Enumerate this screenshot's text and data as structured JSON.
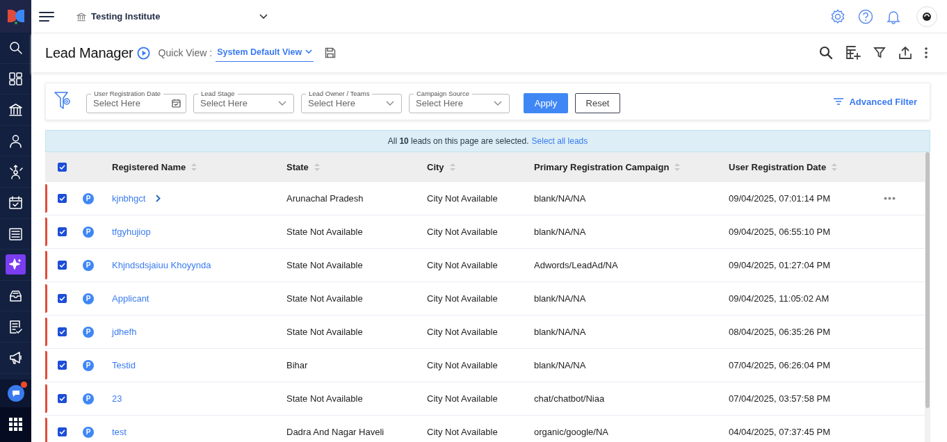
{
  "sidebar": {
    "items": [
      {
        "selected": false
      },
      {
        "selected": false
      },
      {
        "selected": false
      },
      {
        "selected": false
      },
      {
        "selected": false
      },
      {
        "selected": false
      },
      {
        "selected": false
      },
      {
        "selected": true
      },
      {
        "selected": false
      },
      {
        "selected": false
      },
      {
        "selected": false
      }
    ],
    "chat": {
      "has_notification": true
    }
  },
  "topbar": {
    "institute": "Testing Institute"
  },
  "header": {
    "title": "Lead Manager",
    "quick_view_label": "Quick View :",
    "quick_view_value": "System Default View"
  },
  "filters": {
    "fields": [
      {
        "label": "User Registration Date",
        "placeholder": "Select Here",
        "kind": "date"
      },
      {
        "label": "Lead Stage",
        "placeholder": "Select Here",
        "kind": "select"
      },
      {
        "label": "Lead Owner / Teams",
        "placeholder": "Select Here",
        "kind": "select"
      },
      {
        "label": "Campaign Source",
        "placeholder": "Select Here",
        "kind": "select"
      }
    ],
    "apply": "Apply",
    "reset": "Reset",
    "advanced": "Advanced Filter"
  },
  "selection_banner": {
    "text": "All **10** leads on this page are selected.",
    "link": "Select all leads"
  },
  "table": {
    "all_selected": true,
    "columns": [
      "Registered Name",
      "State",
      "City",
      "Primary Registration Campaign",
      "User Registration Date"
    ],
    "rows": [
      {
        "selected": true,
        "badge": "P",
        "name": "kjnbhgct",
        "expandable": true,
        "state": "Arunachal Pradesh",
        "city": "City Not Available",
        "campaign": "blank/NA/NA",
        "date": "09/04/2025, 07:01:14 PM",
        "show_actions": true
      },
      {
        "selected": true,
        "badge": "P",
        "name": "tfgyhujiop",
        "expandable": false,
        "state": "State Not Available",
        "city": "City Not Available",
        "campaign": "blank/NA/NA",
        "date": "09/04/2025, 06:55:10 PM",
        "show_actions": false
      },
      {
        "selected": true,
        "badge": "P",
        "name": "Khjndsdsjaiuu Khoyynda",
        "expandable": false,
        "state": "State Not Available",
        "city": "City Not Available",
        "campaign": "Adwords/LeadAd/NA",
        "date": "09/04/2025, 01:27:04 PM",
        "show_actions": false
      },
      {
        "selected": true,
        "badge": "P",
        "name": "Applicant",
        "expandable": false,
        "state": "State Not Available",
        "city": "City Not Available",
        "campaign": "blank/NA/NA",
        "date": "09/04/2025, 11:05:02 AM",
        "show_actions": false
      },
      {
        "selected": true,
        "badge": "P",
        "name": "jdhefh",
        "expandable": false,
        "state": "State Not Available",
        "city": "City Not Available",
        "campaign": "blank/NA/NA",
        "date": "08/04/2025, 06:35:26 PM",
        "show_actions": false
      },
      {
        "selected": true,
        "badge": "P",
        "name": "Testid",
        "expandable": false,
        "state": "Bihar",
        "city": "City Not Available",
        "campaign": "blank/NA/NA",
        "date": "07/04/2025, 06:26:04 PM",
        "show_actions": false
      },
      {
        "selected": true,
        "badge": "P",
        "name": "23",
        "expandable": false,
        "state": "State Not Available",
        "city": "City Not Available",
        "campaign": "chat/chatbot/Niaa",
        "date": "07/04/2025, 03:57:58 PM",
        "show_actions": false
      },
      {
        "selected": true,
        "badge": "P",
        "name": "test",
        "expandable": false,
        "state": "Dadra And Nagar Haveli",
        "city": "City Not Available",
        "campaign": "organic/google/NA",
        "date": "04/04/2025, 07:37:45 PM",
        "show_actions": false
      }
    ]
  }
}
